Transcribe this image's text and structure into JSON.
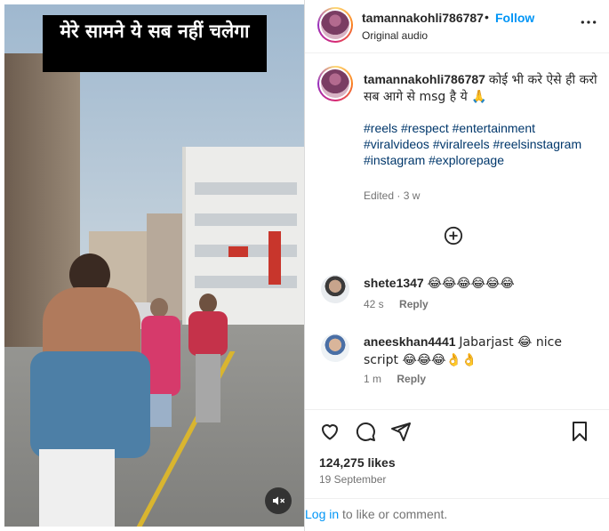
{
  "video": {
    "caption": "मेरे सामने ये सब नहीं चलेगा",
    "mute_icon": "muted-speaker-icon"
  },
  "header": {
    "username": "tamannakohli786787",
    "separator": "•",
    "follow_label": "Follow",
    "audio_label": "Original audio",
    "more_icon": "more-options-icon"
  },
  "post": {
    "username": "tamannakohli786787",
    "caption_text": "कोई भी करे ऐसे ही करो सब आगे से msg है ये 🙏",
    "hashtags": "#reels #respect #entertainment #viralvideos #viralreels #reelsinstagram #instagram #explorepage",
    "edited": "Edited · 3 w",
    "load_more_icon": "plus-circle-icon"
  },
  "comments": [
    {
      "username": "shete1347",
      "text": "😂😂😂😂😂😂",
      "time": "42 s",
      "reply_label": "Reply"
    },
    {
      "username": "aneeskhan4441",
      "text": "Jabarjast 😂 nice script 😂😂😂👌👌",
      "time": "1 m",
      "reply_label": "Reply"
    }
  ],
  "actions": {
    "like_icon": "heart-icon",
    "comment_icon": "comment-bubble-icon",
    "share_icon": "paper-plane-icon",
    "save_icon": "bookmark-icon"
  },
  "stats": {
    "likes": "124,275 likes",
    "date": "19 September"
  },
  "footer": {
    "login_link": "Log in",
    "login_suffix": " to like or comment."
  }
}
